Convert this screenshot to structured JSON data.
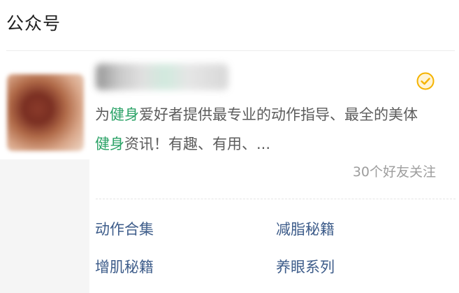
{
  "section": {
    "title": "公众号"
  },
  "account": {
    "name": "",
    "verified_icon": "verified-check-icon",
    "description_parts": [
      {
        "text": "为",
        "highlight": false
      },
      {
        "text": "健身",
        "highlight": true
      },
      {
        "text": "爱好者提供最专业的动作指导、最全的美体",
        "highlight": false
      },
      {
        "text": "健身",
        "highlight": true
      },
      {
        "text": "资讯！有趣、有用、...",
        "highlight": false
      }
    ],
    "followers_text": "30个好友关注"
  },
  "menu": {
    "items": [
      {
        "label": "动作合集"
      },
      {
        "label": "减脂秘籍"
      },
      {
        "label": "增肌秘籍"
      },
      {
        "label": "养眼系列"
      }
    ]
  },
  "colors": {
    "highlight": "#2aa266",
    "menu_link": "#3d5c8a",
    "verified": "#f5b300"
  }
}
